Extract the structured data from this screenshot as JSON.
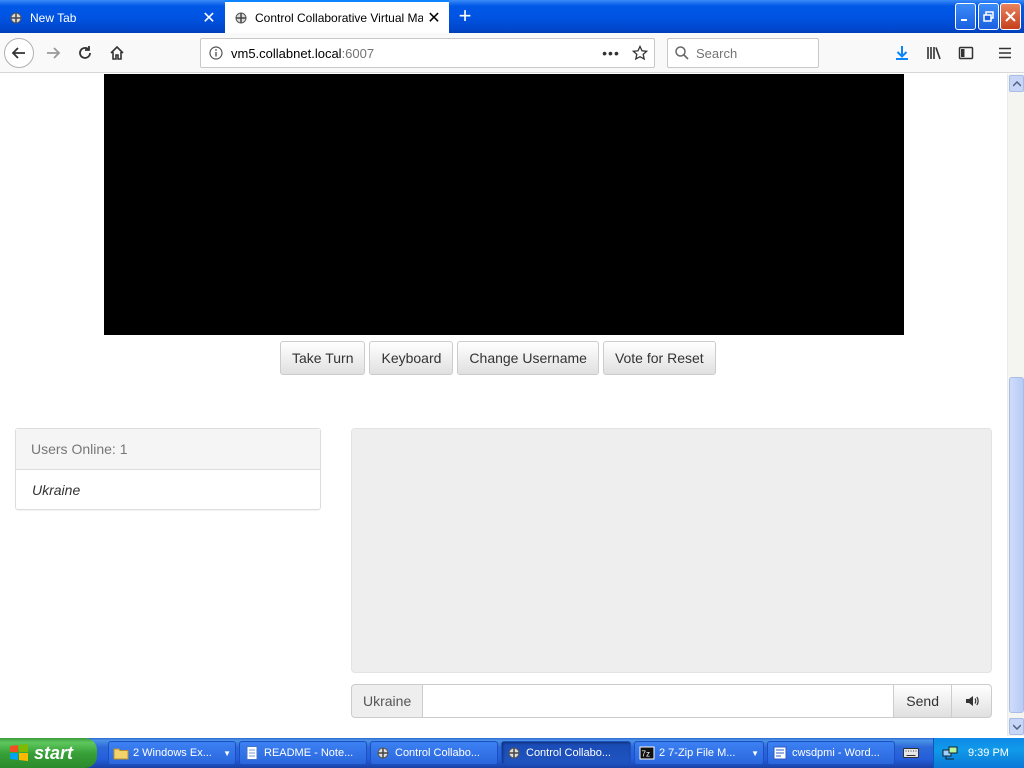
{
  "browser": {
    "tabs": [
      {
        "title": "New Tab",
        "active": false
      },
      {
        "title": "Control Collaborative Virtual Machines!",
        "active": true
      }
    ],
    "url_domain": "vm5.collabnet.local",
    "url_port": ":6007",
    "page_actions_label": "•••",
    "search_placeholder": "Search"
  },
  "page": {
    "controls": [
      {
        "label": "Take Turn"
      },
      {
        "label": "Keyboard"
      },
      {
        "label": "Change Username"
      },
      {
        "label": "Vote for Reset"
      }
    ],
    "users_panel": {
      "header": "Users Online: 1",
      "users": [
        "Ukraine"
      ]
    },
    "chat": {
      "username_label": "Ukraine",
      "input_value": "",
      "send_label": "Send"
    }
  },
  "taskbar": {
    "start_label": "start",
    "tasks": [
      {
        "label": "2 Windows Ex..."
      },
      {
        "label": "README - Note..."
      },
      {
        "label": "Control Collabo..."
      },
      {
        "label": "Control Collabo..."
      },
      {
        "label": "2 7-Zip File M..."
      },
      {
        "label": "cwsdpmi - Word..."
      }
    ],
    "clock": "9:39 PM"
  },
  "colors": {
    "accent": "#0a84ff",
    "vm_screen": "#000000",
    "chat_bg": "#eeeeee",
    "xp_blue": "#0054e3",
    "start_green": "#38a138"
  },
  "icons": [
    "browser-favicon",
    "close-icon",
    "plus-icon",
    "minimize-icon",
    "maximize-icon",
    "window-close-icon",
    "back-arrow-icon",
    "forward-arrow-icon",
    "reload-icon",
    "home-icon",
    "info-icon",
    "star-icon",
    "search-icon",
    "download-icon",
    "library-icon",
    "sidebar-icon",
    "hamburger-menu-icon",
    "speaker-icon",
    "windows-flag-icon",
    "folder-icon",
    "notepad-icon",
    "7zip-icon",
    "wordpad-icon",
    "keyboard-icon",
    "network-icon"
  ]
}
